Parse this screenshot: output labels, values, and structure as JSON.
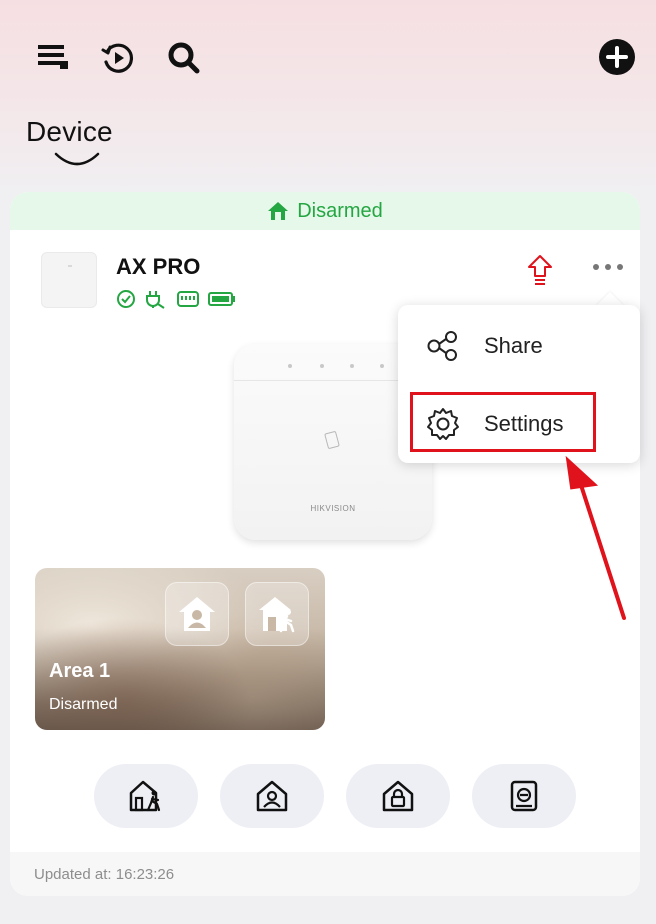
{
  "header": {
    "title": "Device",
    "icons": [
      "menu-icon",
      "playback-icon",
      "search-icon",
      "add-device-icon"
    ]
  },
  "status_banner": {
    "label": "Disarmed",
    "icon": "home-icon",
    "color": "#24a642"
  },
  "device": {
    "name": "AX PRO",
    "status_icons": [
      "online-check-icon",
      "power-plug-icon",
      "network-icon",
      "battery-icon"
    ],
    "image_brand": "HIKVISION"
  },
  "menu": {
    "items": [
      {
        "label": "Share",
        "icon": "share-icon"
      },
      {
        "label": "Settings",
        "icon": "gear-icon"
      }
    ],
    "highlighted": "Settings",
    "highlight_color": "#e0121b"
  },
  "area": {
    "name": "Area 1",
    "status": "Disarmed",
    "buttons": [
      "stay-arm-icon",
      "away-arm-icon"
    ]
  },
  "mode_buttons": [
    "away-arm-icon",
    "stay-arm-icon",
    "arm-icon",
    "disarm-icon"
  ],
  "footer": {
    "updated": "Updated at: 16:23:26"
  }
}
